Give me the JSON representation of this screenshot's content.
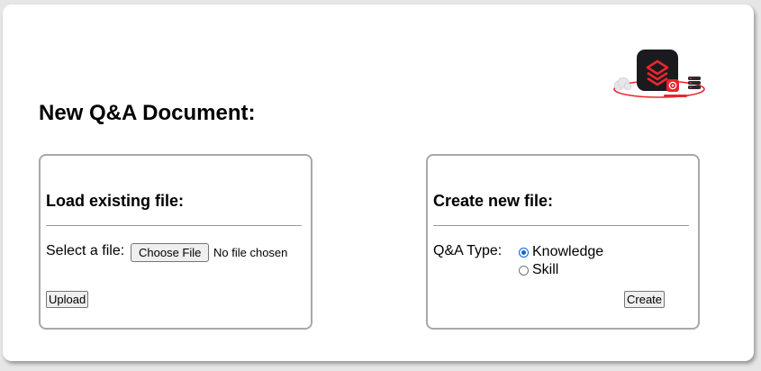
{
  "page": {
    "title": "New Q&A Document:"
  },
  "load_panel": {
    "heading": "Load existing file:",
    "select_label": "Select a file:",
    "choose_file_label": "Choose File",
    "file_status": "No file chosen",
    "upload_label": "Upload"
  },
  "create_panel": {
    "heading": "Create new file:",
    "type_label": "Q&A Type:",
    "options": [
      {
        "label": "Knowledge",
        "selected": true
      },
      {
        "label": "Skill",
        "selected": false
      }
    ],
    "create_label": "Create"
  },
  "colors": {
    "accent": "#0a66d6",
    "logo_red": "#e8262d",
    "logo_dark": "#1b1b1f"
  }
}
